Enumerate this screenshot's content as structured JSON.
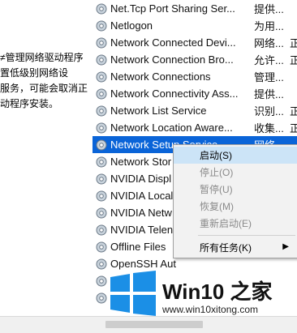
{
  "left_description": "≠管理网络驱动程序\n置低级别网络设\n服务，可能会取消正\n动程序安装。",
  "services": [
    {
      "name": "Net.Tcp Port Sharing Ser...",
      "desc": "提供...",
      "status": ""
    },
    {
      "name": "Netlogon",
      "desc": "为用...",
      "status": ""
    },
    {
      "name": "Network Connected Devi...",
      "desc": "网络...",
      "status": "正在"
    },
    {
      "name": "Network Connection Bro...",
      "desc": "允许...",
      "status": "正在"
    },
    {
      "name": "Network Connections",
      "desc": "管理...",
      "status": ""
    },
    {
      "name": "Network Connectivity Ass...",
      "desc": "提供...",
      "status": ""
    },
    {
      "name": "Network List Service",
      "desc": "识别...",
      "status": "正在"
    },
    {
      "name": "Network Location Aware...",
      "desc": "收集...",
      "status": "正在"
    },
    {
      "name": "Network Setup Service",
      "desc": "网络...",
      "status": ""
    },
    {
      "name": "Network Stor",
      "desc": "",
      "status": ""
    },
    {
      "name": "NVIDIA Displ",
      "desc": "",
      "status": ""
    },
    {
      "name": "NVIDIA Local",
      "desc": "",
      "status": ""
    },
    {
      "name": "NVIDIA Netw",
      "desc": "",
      "status": ""
    },
    {
      "name": "NVIDIA Telen",
      "desc": "",
      "status": ""
    },
    {
      "name": "Offline Files",
      "desc": "",
      "status": ""
    },
    {
      "name": "OpenSSH Aut",
      "desc": "",
      "status": ""
    },
    {
      "name": "",
      "desc": "",
      "status": ""
    },
    {
      "name": "",
      "desc": "",
      "status": ""
    }
  ],
  "context_menu": {
    "start": "启动(S)",
    "stop": "停止(O)",
    "pause": "暂停(U)",
    "resume": "恢复(M)",
    "restart": "重新启动(E)",
    "all_tasks": "所有任务(K)",
    "all_tasks_arrow": "▶"
  },
  "logo": {
    "brand": "Win10 之家",
    "site": "www.win10xitong.com"
  },
  "colors": {
    "selection": "#0a64d8",
    "menu_hover": "#cce4f7",
    "logo_blue": "#1b8fe6"
  }
}
